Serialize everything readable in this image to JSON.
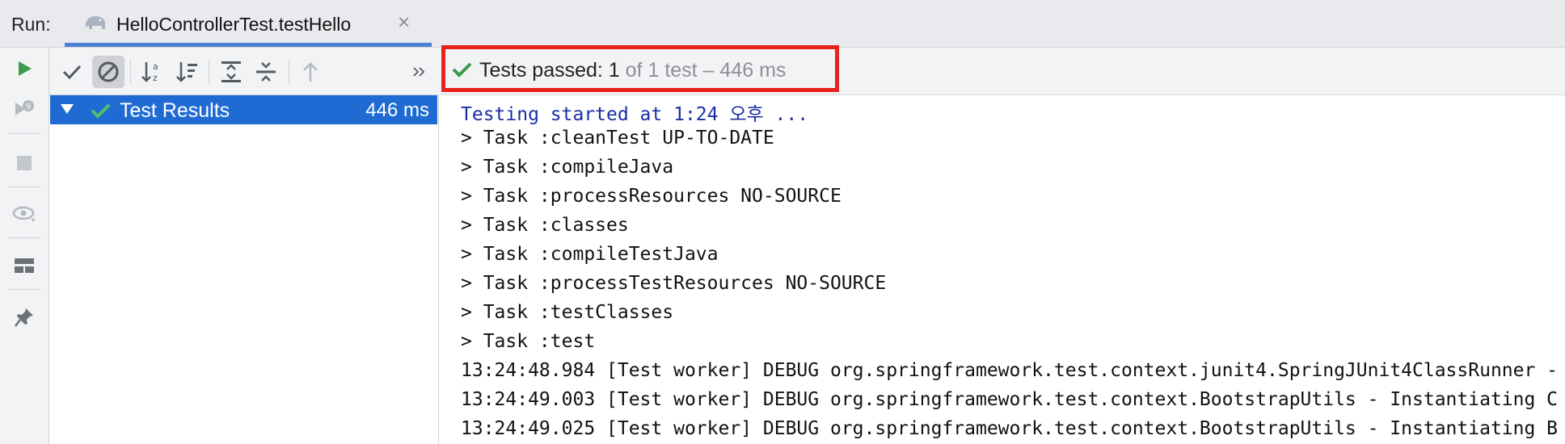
{
  "run_bar": {
    "label": "Run:",
    "tab_title": "HelloControllerTest.testHello",
    "close_glyph": "×"
  },
  "status": {
    "passed_text": "Tests passed: 1",
    "detail_text": "of 1 test – 446 ms"
  },
  "tree": {
    "root_label": "Test Results",
    "root_time": "446 ms"
  },
  "console": {
    "lines": [
      "Testing started at 1:24 오후 ...",
      "> Task :cleanTest UP-TO-DATE",
      "> Task :compileJava",
      "> Task :processResources NO-SOURCE",
      "> Task :classes",
      "> Task :compileTestJava",
      "> Task :processTestResources NO-SOURCE",
      "> Task :testClasses",
      "> Task :test",
      "13:24:48.984 [Test worker] DEBUG org.springframework.test.context.junit4.SpringJUnit4ClassRunner -",
      "13:24:49.003 [Test worker] DEBUG org.springframework.test.context.BootstrapUtils - Instantiating C",
      "13:24:49.025 [Test worker] DEBUG org.springframework.test.context.BootstrapUtils - Instantiating B"
    ]
  },
  "icons": {
    "left": [
      "run-icon",
      "rerun-failed-icon",
      "stop-icon",
      "view-icon",
      "layout-icon",
      "pin-icon"
    ],
    "toolbar": [
      "show-passed-icon",
      "show-ignored-icon",
      "sort-alpha-icon",
      "sort-duration-icon",
      "expand-all-icon",
      "collapse-all-icon",
      "previous-failed-icon",
      "more-icon"
    ]
  },
  "colors": {
    "accent": "#1f6bd3",
    "pass_green": "#3d9a4b",
    "highlight_red": "#e8231c"
  }
}
